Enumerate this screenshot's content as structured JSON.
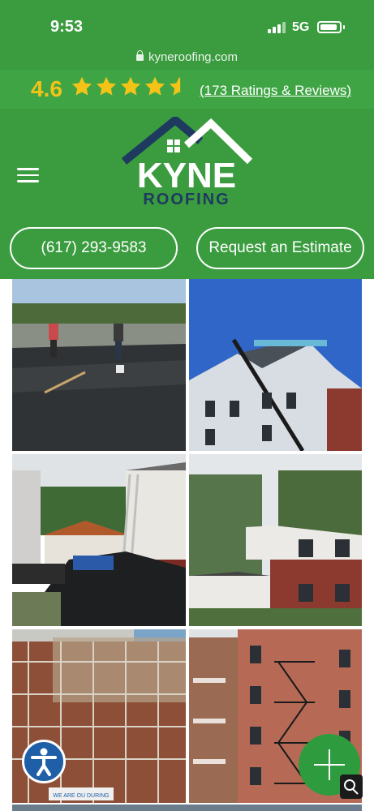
{
  "status_bar": {
    "time": "9:53",
    "network": "5G"
  },
  "browser": {
    "url": "kyneroofing.com"
  },
  "rating": {
    "score": "4.6",
    "stars_value": 4.6,
    "stars_max": 5,
    "reviews_link": "(173 Ratings & Reviews)",
    "star_color": "#f4c318"
  },
  "logo": {
    "line1": "KYNE",
    "line2": "ROOFING",
    "brand_color": "#1e3a5f"
  },
  "header": {
    "background": "#3a9c3f"
  },
  "actions": {
    "phone": "(617) 293-9583",
    "estimate": "Request an Estimate"
  },
  "gallery": {
    "photos": [
      {
        "name": "roof-membrane-install"
      },
      {
        "name": "triple-decker-roof"
      },
      {
        "name": "ladder-roof-repair"
      },
      {
        "name": "colonial-house-roof"
      },
      {
        "name": "scaffolding-brick-building"
      },
      {
        "name": "brick-fire-escape-building"
      }
    ],
    "banner_text": "WE ARE OU DURING"
  },
  "fab": {
    "icon": "plus-icon",
    "color": "#2e9b3e"
  },
  "accessibility": {
    "icon": "accessibility-icon",
    "color": "#1f5fa8"
  }
}
